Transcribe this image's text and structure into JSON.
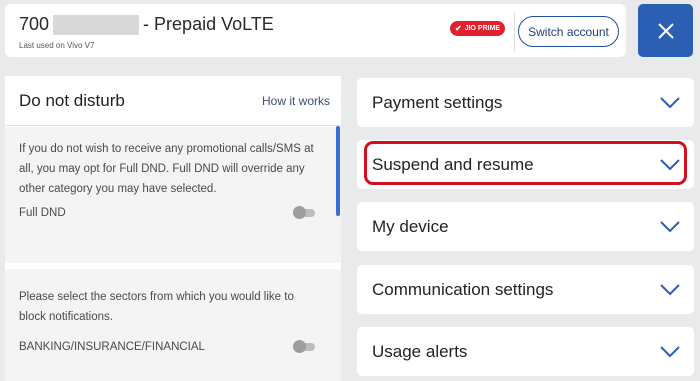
{
  "header": {
    "account_number_prefix": "700",
    "plan": "- Prepaid VoLTE",
    "last_used": "Last used on Vivo V7",
    "prime_badge": "JIO PRIME",
    "switch_account": "Switch account",
    "close_icon": "close-icon"
  },
  "dnd": {
    "title": "Do not disturb",
    "how_it_works": "How it works",
    "description": "If you do not wish to receive any promotional calls/SMS at all, you may opt for Full DND. Full DND will override any other category you may have selected.",
    "full_dnd_label": "Full DND",
    "full_dnd_on": false,
    "sectors_prompt": "Please select the sectors from which you would like to block notifications.",
    "sectors": [
      {
        "label": "BANKING/INSURANCE/FINANCIAL",
        "on": false
      }
    ]
  },
  "settings": {
    "items": [
      {
        "label": "Payment settings"
      },
      {
        "label": "Suspend and resume"
      },
      {
        "label": "My device"
      },
      {
        "label": "Communication settings"
      },
      {
        "label": "Usage alerts"
      }
    ],
    "highlighted_item": "Suspend and resume",
    "highlight_color": "#d0101d"
  },
  "colors": {
    "brand_blue": "#2a5fb3",
    "prime_red": "#e0222e"
  }
}
